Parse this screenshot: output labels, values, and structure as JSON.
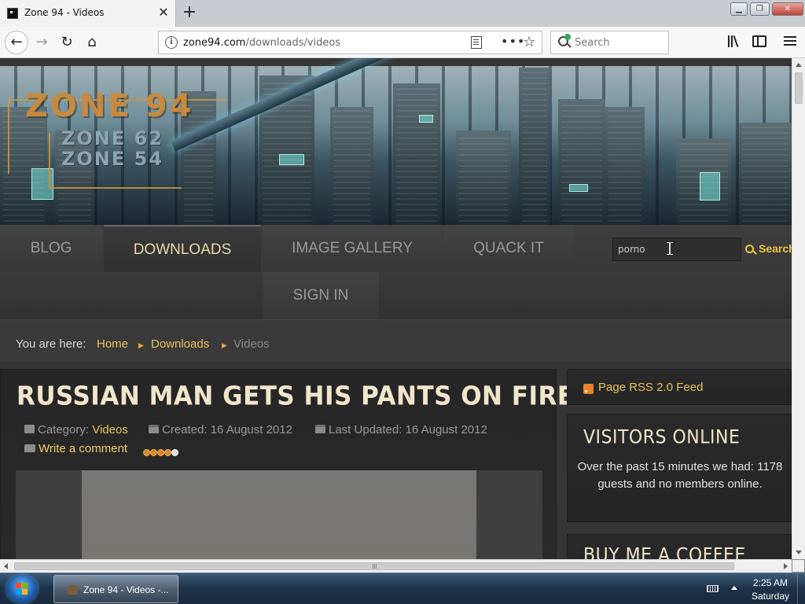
{
  "browser": {
    "tab_title": "Zone 94 - Videos",
    "url_domain": "zone94.com",
    "url_path": "/downloads/videos",
    "search_placeholder": "Search",
    "new_tab_symbol": "+",
    "close_tab_symbol": "✕",
    "window_min_symbol": "▁",
    "window_max_symbol": "❐",
    "window_close_symbol": "✕"
  },
  "site": {
    "logo_main": "ZONE 94",
    "logo_sub1": "ZONE 62",
    "logo_sub2": "ZONE 54",
    "nav": {
      "blog": "BLOG",
      "downloads": "DOWNLOADS",
      "image_gallery": "IMAGE GALLERY",
      "quack_it": "QUACK IT",
      "sign_in": "SIGN IN"
    },
    "search": {
      "value": "porno",
      "button_label": "Search"
    },
    "breadcrumb": {
      "lead": "You are here:",
      "items": [
        "Home",
        "Downloads",
        "Videos"
      ]
    },
    "article": {
      "title": "RUSSIAN MAN GETS HIS PANTS ON FIRE",
      "category_label": "Category:",
      "category": "Videos",
      "created": "Created: 16 August 2012",
      "updated": "Last Updated: 16 August 2012",
      "comment_link": "Write a comment",
      "rating": {
        "value": 4,
        "max": 5
      }
    },
    "sidebar": {
      "rss": "Page RSS 2.0 Feed",
      "visitors_title": "VISITORS ONLINE",
      "visitors_text": "Over the past 15 minutes we had: 1178 guests and no members online.",
      "coffee_title": "BUY ME A COFFEE"
    }
  },
  "taskbar": {
    "task_label": "Zone 94 - Videos -...",
    "time": "2:25 AM",
    "day": "Saturday"
  },
  "colors": {
    "accent_gold": "#e8c25b",
    "title_cream": "#f1e6cc",
    "rss_orange": "#e8832a"
  }
}
